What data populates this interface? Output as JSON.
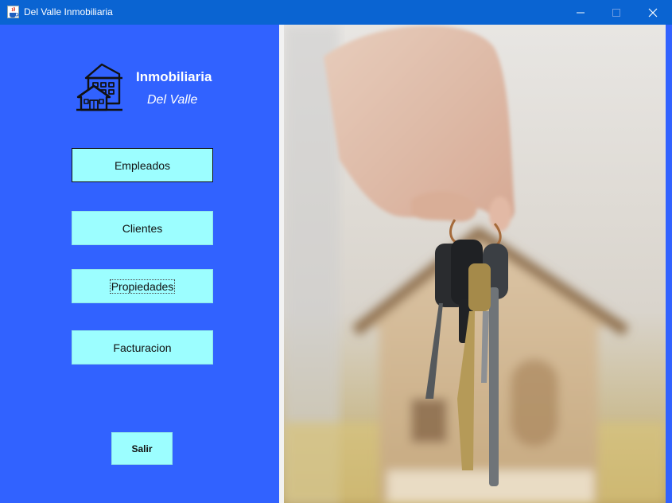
{
  "window": {
    "title": "Del Valle Inmobiliaria",
    "app_icon": "java-cup-icon",
    "controls": [
      "minimize-icon",
      "maximize-icon",
      "close-icon"
    ]
  },
  "brand": {
    "name_line1": "Inmobiliaria",
    "name_line2": "Del Valle",
    "logo_icon": "buildings-icon"
  },
  "menu": {
    "employees": "Empleados",
    "clients": "Clientes",
    "properties": "Propiedades",
    "billing": "Facturacion"
  },
  "exit_label": "Salir",
  "colors": {
    "titlebar": "#0a64d2",
    "panel": "#3162ff",
    "button": "#9cfeff"
  }
}
